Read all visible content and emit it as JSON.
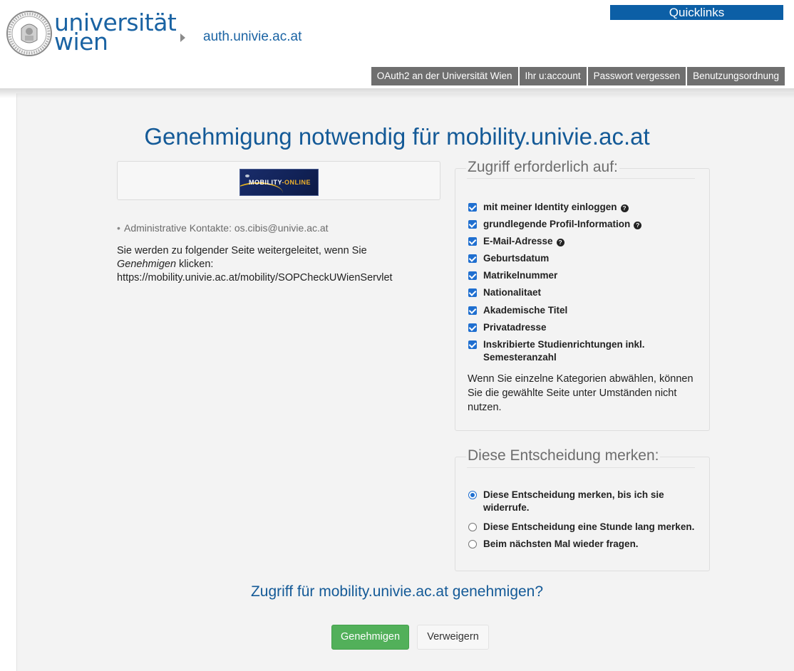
{
  "header": {
    "logo": {
      "line1": "universität",
      "line2": "wien"
    },
    "breadcrumb_host": "auth.univie.ac.at",
    "quicklinks_label": "Quicklinks",
    "nav": [
      {
        "label": "OAuth2 an der Universität Wien"
      },
      {
        "label": "Ihr u:account"
      },
      {
        "label": "Passwort vergessen"
      },
      {
        "label": "Benutzungsordnung"
      }
    ]
  },
  "main": {
    "title": "Genehmigung notwendig für mobility.univie.ac.at",
    "sp_logo": {
      "text_a": "MOBILITY",
      "text_b": "-ONLINE"
    },
    "contacts": "Administrative Kontakte: os.cibis@univie.ac.at",
    "redirect": {
      "line1": "Sie werden zu folgender Seite weitergeleitet, wenn Sie",
      "em": "Genehmigen",
      "line2_rest": " klicken:",
      "url": "https://mobility.univie.ac.at/mobility/SOPCheckUWienServlet"
    },
    "attributes": {
      "legend": "Zugriff erforderlich auf:",
      "items": [
        {
          "label": "mit meiner Identity einloggen",
          "checked": true,
          "help": true
        },
        {
          "label": "grundlegende Profil-Information",
          "checked": true,
          "help": true
        },
        {
          "label": "E-Mail-Adresse",
          "checked": true,
          "help": true
        },
        {
          "label": "Geburtsdatum",
          "checked": true,
          "help": false
        },
        {
          "label": "Matrikelnummer",
          "checked": true,
          "help": false
        },
        {
          "label": "Nationalitaet",
          "checked": true,
          "help": false
        },
        {
          "label": "Akademische Titel",
          "checked": true,
          "help": false
        },
        {
          "label": "Privatadresse",
          "checked": true,
          "help": false
        },
        {
          "label": "Inskribierte Studienrichtungen inkl. Semesteranzahl",
          "checked": true,
          "help": false
        }
      ],
      "warning": "Wenn Sie einzelne Kategorien abwählen, können Sie die gewählte Seite unter Umständen nicht nutzen."
    },
    "remember": {
      "legend": "Diese Entscheidung merken:",
      "options": [
        {
          "label": "Diese Entscheidung merken, bis ich sie widerrufe.",
          "selected": true
        },
        {
          "label": "Diese Entscheidung eine Stunde lang merken.",
          "selected": false
        },
        {
          "label": "Beim nächsten Mal wieder fragen.",
          "selected": false
        }
      ]
    },
    "question": "Zugriff für mobility.univie.ac.at genehmigen?",
    "approve_label": "Genehmigen",
    "deny_label": "Verweigern"
  },
  "colors": {
    "brand_blue": "#145a97",
    "quicklinks_bg": "#0c5fa6",
    "nav_bg": "#6f6f6f",
    "approve_green": "#52b05a",
    "checkbox_blue": "#1f6fd0"
  }
}
